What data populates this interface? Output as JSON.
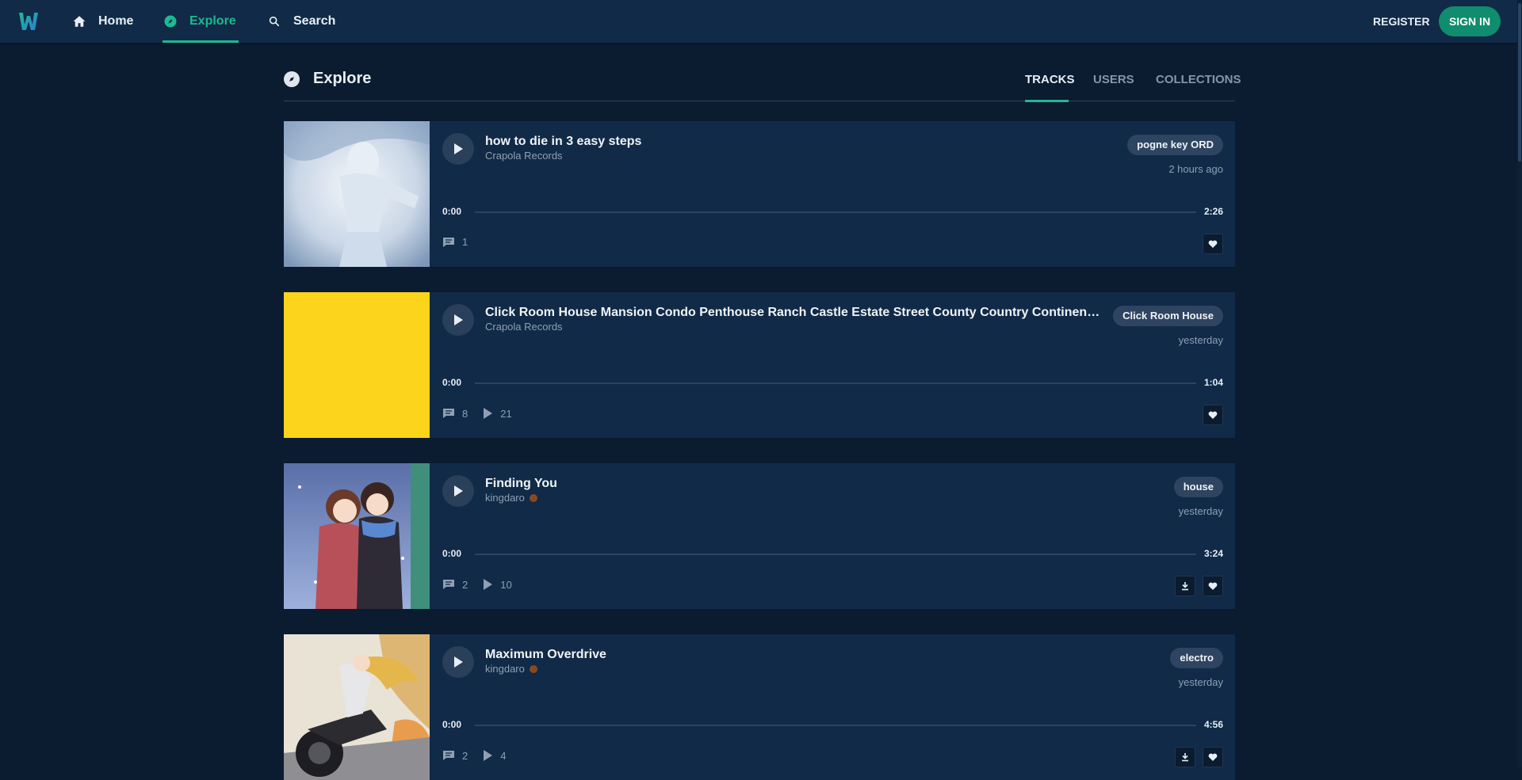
{
  "nav": {
    "home": "Home",
    "explore": "Explore",
    "search": "Search",
    "register": "REGISTER",
    "sign_in": "SIGN IN"
  },
  "page": {
    "title": "Explore",
    "tabs": [
      "TRACKS",
      "USERS",
      "COLLECTIONS"
    ],
    "active_tab": "TRACKS"
  },
  "tracks": [
    {
      "title": "how to die in 3 easy steps",
      "artist": "Crapola Records",
      "tag": "pogne key ORD",
      "time_ago": "2 hours ago",
      "current_time": "0:00",
      "duration": "2:26",
      "comments": "1",
      "plays": "",
      "downloadable": false
    },
    {
      "title": "Click Room House Mansion Condo Penthouse Ranch Castle Estate Street County Country Continent Globe U...",
      "artist": "Crapola Records",
      "tag": "Click Room House",
      "time_ago": "yesterday",
      "current_time": "0:00",
      "duration": "1:04",
      "comments": "8",
      "plays": "21",
      "downloadable": false
    },
    {
      "title": "Finding You",
      "artist": "kingdaro",
      "tag": "house",
      "time_ago": "yesterday",
      "current_time": "0:00",
      "duration": "3:24",
      "comments": "2",
      "plays": "10",
      "downloadable": true
    },
    {
      "title": "Maximum Overdrive",
      "artist": "kingdaro",
      "tag": "electro",
      "time_ago": "yesterday",
      "current_time": "0:00",
      "duration": "4:56",
      "comments": "2",
      "plays": "4",
      "downloadable": true
    }
  ],
  "colors": {
    "accent": "#1db992",
    "background": "#0b1b30",
    "card": "#102a47",
    "sign_in": "#108c6e"
  }
}
